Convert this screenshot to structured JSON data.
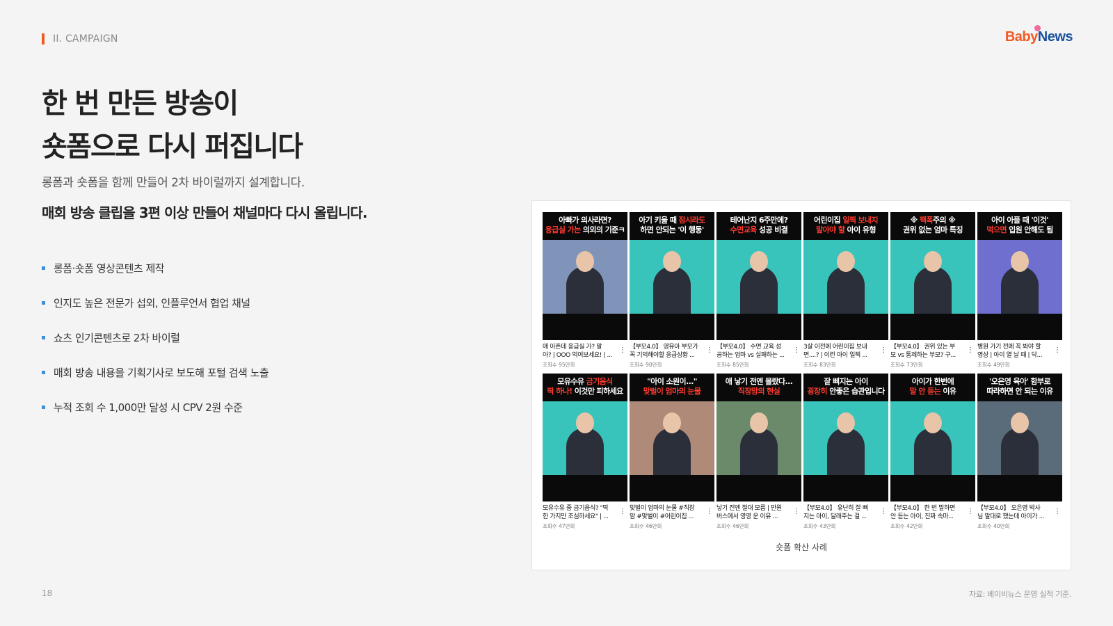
{
  "header": {
    "section": "II. CAMPAIGN",
    "logo_brand": "Baby",
    "logo_news": "News"
  },
  "headline": {
    "line1": "한 번 만든 방송이",
    "line2": "숏폼으로 다시 퍼집니다"
  },
  "subline": "롱폼과 숏폼을 함께 만들어 2차 바이럴까지 설계합니다.",
  "boldline": "매회 방송 클립을 3편 이상 만들어 채널마다 다시 올립니다.",
  "bullets": [
    "롱폼·숏폼 영상콘텐츠 제작",
    "인지도 높은 전문가 섭외, 인플루언서 협업 채널",
    "쇼츠 인기콘텐츠로 2차 바이럴",
    "매회 방송 내용을 기획기사로 보도해 포털 검색 노출",
    "누적 조회 수 1,000만 달성 시 CPV 2원 수준"
  ],
  "panel": {
    "caption": "숏폼 확산 사례",
    "videos": [
      {
        "t1": "아빠가 의사라면?",
        "t2a": "응급실 가는",
        "t2b": " 의외의 기준ㅋ",
        "title1": "애 아픈데 응급실 가? 말",
        "title2": "아? | OOO 먹여보세요! | ...",
        "views": "조회수 95만회",
        "bg": "#7f94b8"
      },
      {
        "t1a": "아기 키울 때 ",
        "t1b": "잠시라도",
        "t2": "하면 안되는 '이 행동'",
        "title1": "【부모4.0】 영유아 부모가",
        "title2": "꼭 기억해야할 응급상황 ...",
        "views": "조회수 90만회",
        "bg": "#39c4bb"
      },
      {
        "t1": "테어난지 6주만에?",
        "t2a": "수면교육",
        "t2b": " 성공 비결",
        "title1": "【부모4.0】 수면 교육 성",
        "title2": "공하는 엄마 vs 실패하는 ...",
        "views": "조회수 85만회",
        "bg": "#39c4bb"
      },
      {
        "t1a": "어린이집 ",
        "t1b": "일찍 보내지",
        "t2a": "말아야 할",
        "t2b": " 아이 유형",
        "title1": "3살 이전에 어린이집 보내",
        "title2": "면....? | 이런 아이 일찍 ...",
        "views": "조회수 83만회",
        "bg": "#39c4bb"
      },
      {
        "t1a": "※ ",
        "t1b": "팩폭",
        "t1c": "주의 ※",
        "t2": "권위 없는 엄마 특징",
        "title1": "【부모4.0】 권위 있는 부",
        "title2": "모 vs 통제하는 부모? 구...",
        "views": "조회수 73만회",
        "bg": "#39c4bb"
      },
      {
        "t1": "아이 아플 때 '이것'",
        "t2a": "먹으면 ",
        "t2b": "입원 안해도 됨",
        "title1": "병원 가기 전에 꼭 봐야 할",
        "title2": "영상 | 아이 열 날 때 | 닥...",
        "views": "조회수 49만회",
        "bg": "#6f6fd0"
      },
      {
        "t1a": "모유수유 ",
        "t1b": "금기음식",
        "t2a": "딱 하나! ",
        "t2b": "이것",
        "t2c": "만 피하세요",
        "title1": "모유수유 중 금기음식? \"딱",
        "title2": "한 가지만 조심하세요\" | ...",
        "views": "조회수 47만회",
        "bg": "#39c4bb"
      },
      {
        "t1": "\"아이 소원이...\"",
        "t2a": "맞벌이 엄마의 눈물",
        "title1": "맞벌이 엄마의 눈물 #직장",
        "title2": "맘 #맞벌이 #어린이집 ...",
        "views": "조회수 46만회",
        "bg": "#b08a78"
      },
      {
        "t1": "애 낳기 전엔 몰랐다...",
        "t2a": "직장맘의 현실",
        "title1": "낳기 전엔 절대 모름 | 만원",
        "title2": "버스에서 영영 운 이유 ...",
        "views": "조회수 46만회",
        "bg": "#6a8a6a"
      },
      {
        "t1": "잘 삐지는 아이",
        "t2a": "굉장히 ",
        "t2b": "안좋은",
        "t2c": " 습관입니다",
        "title1": "【부모4.0】 유난히 잘 삐",
        "title2": "지는 아이, 달래주는 걸 ...",
        "views": "조회수 43만회",
        "bg": "#39c4bb"
      },
      {
        "t1": "아이가 한번에",
        "t2a": "말 안 듣는",
        "t2b": " 이유",
        "title1": "【부모4.0】 한 번 말하면",
        "title2": "안 듣는 아이, 진짜 속마...",
        "views": "조회수 42만회",
        "bg": "#39c4bb"
      },
      {
        "t1": "'오은영 육아' 함부로",
        "t2": "따라하면 안 되는 이유",
        "title1": "【부모4.0】 오은영 박사",
        "title2": "님 말대로 했는데 아이가 ...",
        "views": "조회수 40만회",
        "bg": "#5a6b7a"
      }
    ]
  },
  "footer": {
    "page": "18",
    "source": "자료: 베이비뉴스 운영 실적 기준."
  },
  "colors": {
    "accent_orange": "#f05a23",
    "bullet_blue": "#3d8fd8",
    "highlight_red": "#ff3b30"
  }
}
